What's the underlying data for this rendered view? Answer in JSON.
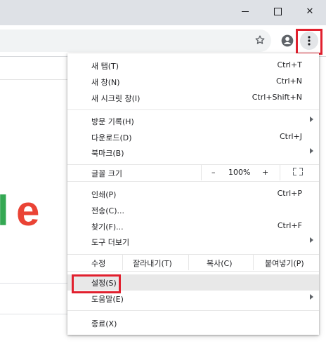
{
  "window_controls": {
    "minimize_icon": "minimize-icon",
    "maximize_icon": "maximize-icon",
    "close_icon": "close-icon",
    "close_label": "✕"
  },
  "toolbar": {
    "bookmark_icon": "star-icon",
    "profile_icon": "account-circle-icon",
    "menu_icon": "more-vertical-icon"
  },
  "page": {
    "logo_partial_l": "l",
    "logo_partial_e": "e"
  },
  "menu": {
    "new_tab": {
      "label": "새 탭(T)",
      "shortcut": "Ctrl+T"
    },
    "new_window": {
      "label": "새 창(N)",
      "shortcut": "Ctrl+N"
    },
    "incognito": {
      "label": "새 시크릿 창(I)",
      "shortcut": "Ctrl+Shift+N"
    },
    "history": {
      "label": "방문 기록(H)"
    },
    "downloads": {
      "label": "다운로드(D)",
      "shortcut": "Ctrl+J"
    },
    "bookmarks": {
      "label": "북마크(B)"
    },
    "zoom": {
      "label": "글꼴 크기",
      "minus": "–",
      "value": "100%",
      "plus": "+"
    },
    "print": {
      "label": "인쇄(P)",
      "shortcut": "Ctrl+P"
    },
    "cast": {
      "label": "전송(C)..."
    },
    "find": {
      "label": "찾기(F)...",
      "shortcut": "Ctrl+F"
    },
    "more_tools": {
      "label": "도구 더보기"
    },
    "edit": {
      "label": "수정",
      "cut": "잘라내기(T)",
      "copy": "복사(C)",
      "paste": "붙여넣기(P)"
    },
    "settings": {
      "label": "설정(S)"
    },
    "help": {
      "label": "도움말(E)"
    },
    "exit": {
      "label": "종료(X)"
    }
  }
}
